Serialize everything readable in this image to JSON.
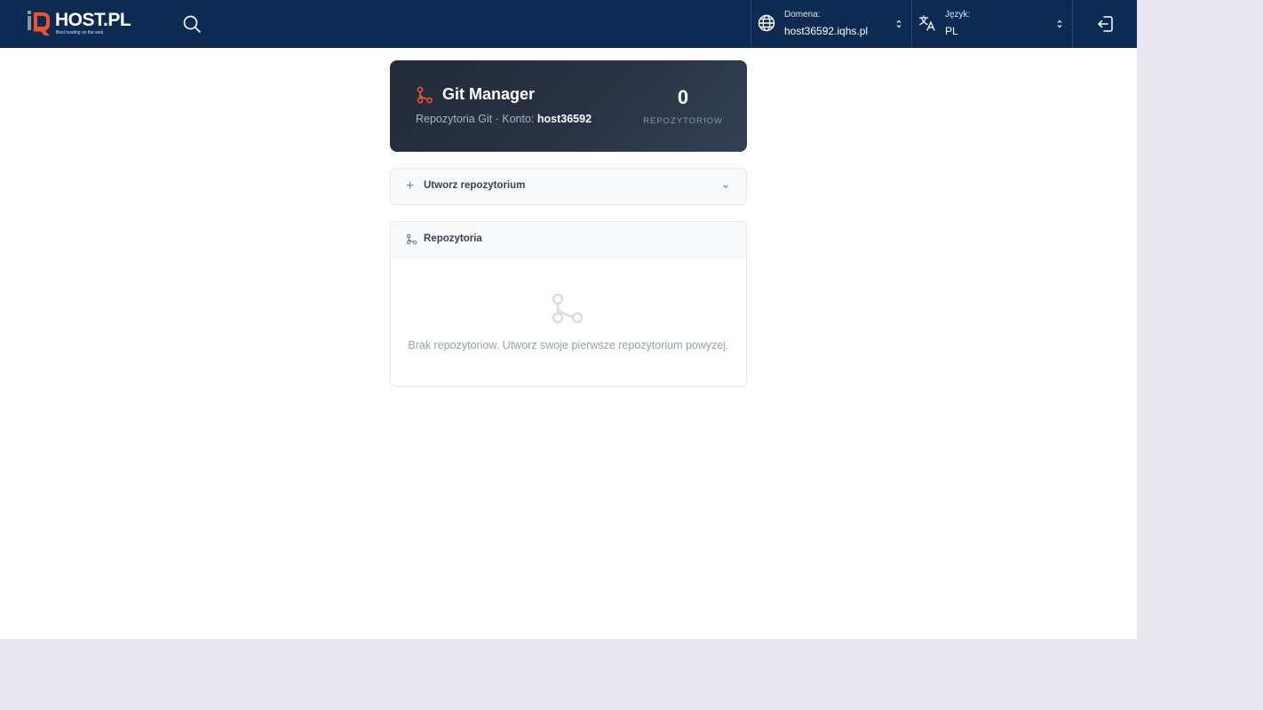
{
  "brand": {
    "name": "HOST.PL",
    "tagline": "Best hosting on the web",
    "accent": "#e8552f",
    "navy": "#0c2a52"
  },
  "header": {
    "search_icon": "search-icon",
    "domain": {
      "label": "Domena:",
      "value": "host36592.iqhs.pl",
      "icon": "globe-icon"
    },
    "language": {
      "label": "Język:",
      "value": "PL",
      "icon": "translate-icon"
    },
    "logout_icon": "logout-icon"
  },
  "hero": {
    "title": "Git Manager",
    "subtitle_prefix": "Repozytoria Git · Konto: ",
    "account": "host36592",
    "count": "0",
    "count_label": "REPOZYTORIOW"
  },
  "create_panel": {
    "title": "Utworz repozytorium"
  },
  "repos_panel": {
    "title": "Repozytoria",
    "empty_message": "Brak repozytoriow. Utworz swoje pierwsze repozytorium powyzej."
  }
}
